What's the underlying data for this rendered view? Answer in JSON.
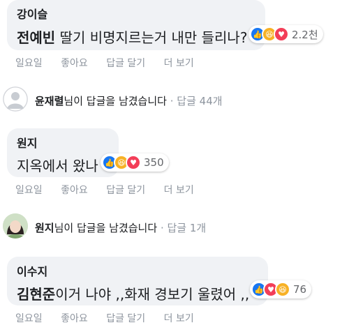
{
  "comment1": {
    "author": "강이슬",
    "mention": "전예빈",
    "text": " 딸기 비명지르는거 내만 들리나?",
    "reaction_count": "2.2천",
    "actions": {
      "time": "일요일",
      "like": "좋아요",
      "reply": "답글 달기",
      "more": "더 보기"
    }
  },
  "reply1": {
    "name": "윤재렬",
    "text": "님이 답글을 남겼습니다",
    "dot": "·",
    "count": "답글 44개"
  },
  "comment2": {
    "author": "원지",
    "text": "지옥에서 왔나",
    "reaction_count": "350",
    "actions": {
      "time": "일요일",
      "like": "좋아요",
      "reply": "답글 달기",
      "more": "더 보기"
    }
  },
  "reply2": {
    "name": "원지",
    "text": "님이 답글을 남겼습니다",
    "dot": "·",
    "count": "답글 1개"
  },
  "comment3": {
    "author": "이수지",
    "mention": "김현준",
    "text": "이거 나야 ,,화재 경보기 울렸어 ,,",
    "reaction_count": "76",
    "actions": {
      "time": "일요일",
      "like": "좋아요",
      "reply": "답글 달기",
      "more": "더 보기"
    }
  },
  "colors": {
    "bubble": "#f0f2f5",
    "like": "#1877f2",
    "haha": "#f7b125",
    "love": "#f33e58",
    "meta": "#8d949e"
  },
  "icons": [
    "like-icon",
    "haha-icon",
    "love-icon",
    "default-avatar-icon"
  ]
}
